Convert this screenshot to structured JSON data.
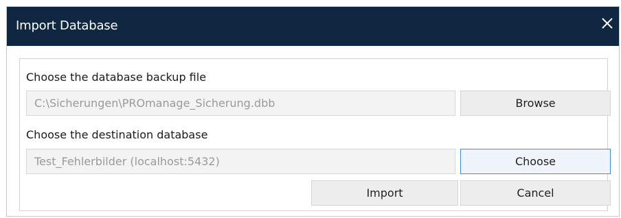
{
  "window": {
    "title": "Import Database",
    "close_icon": "close-icon"
  },
  "backup": {
    "label": "Choose the database backup file",
    "path_value": "C:\\Sicherungen\\PROmanage_Sicherung.dbb",
    "browse_label": "Browse"
  },
  "destination": {
    "label": "Choose the destination database",
    "db_value": "Test_Fehlerbilder (localhost:5432)",
    "choose_label": "Choose"
  },
  "actions": {
    "import_label": "Import",
    "cancel_label": "Cancel"
  },
  "colors": {
    "titlebar": "#0f2740",
    "focus_accent": "#3b8fd9"
  }
}
